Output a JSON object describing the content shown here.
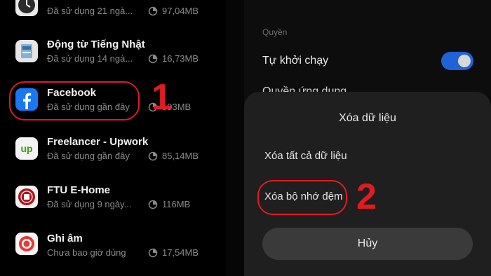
{
  "apps": [
    {
      "name": "",
      "sub": "Đã sử dụng 21 ngà...",
      "size": "97,04MB",
      "icon": "clock-icon"
    },
    {
      "name": "Động từ Tiếng Nhật",
      "sub": "Đã sử dụng 14 ngà...",
      "size": "16,73MB",
      "icon": "book-icon"
    },
    {
      "name": "Facebook",
      "sub": "Đã sử dụng gần đây",
      "size": "593MB",
      "icon": "facebook-icon"
    },
    {
      "name": "Freelancer - Upwork",
      "sub": "Đã sử dụng gần đây",
      "size": "85,14MB",
      "icon": "upwork-icon"
    },
    {
      "name": "FTU E-Home",
      "sub": "Đã sử dụng 9 ngày...",
      "size": "116MB",
      "icon": "ftu-logo-icon"
    },
    {
      "name": "Ghi âm",
      "sub": "Chưa bao giờ dùng",
      "size": "17,54MB",
      "icon": "recorder-icon"
    }
  ],
  "annotations": {
    "step1": "1",
    "step2": "2",
    "color": "#e11b22"
  },
  "settings": {
    "section_label": "Quyền",
    "autostart_label": "Tự khởi chạy",
    "autostart_on": true,
    "permissions_label": "Quyền ứng dụng"
  },
  "dialog": {
    "title": "Xóa dữ liệu",
    "clear_all": "Xóa tất cả dữ liệu",
    "clear_cache": "Xóa bộ nhớ đệm",
    "cancel": "Hủy"
  },
  "colors": {
    "accent": "#1f63d6",
    "highlight": "#e11b22"
  }
}
